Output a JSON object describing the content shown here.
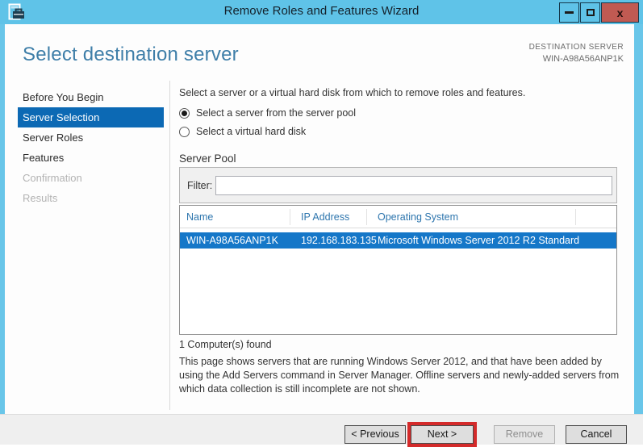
{
  "window": {
    "title": "Remove Roles and Features Wizard",
    "controls": {
      "minimize": "minimize",
      "maximize": "maximize",
      "close_glyph": "x"
    }
  },
  "header": {
    "title": "Select destination server",
    "destination_label": "DESTINATION SERVER",
    "destination_server": "WIN-A98A56ANP1K"
  },
  "sidebar": {
    "items": [
      {
        "label": "Before You Begin",
        "state": "enabled"
      },
      {
        "label": "Server Selection",
        "state": "selected"
      },
      {
        "label": "Server Roles",
        "state": "enabled"
      },
      {
        "label": "Features",
        "state": "enabled"
      },
      {
        "label": "Confirmation",
        "state": "disabled"
      },
      {
        "label": "Results",
        "state": "disabled"
      }
    ]
  },
  "content": {
    "intro": "Select a server or a virtual hard disk from which to remove roles and features.",
    "radio_server_pool": {
      "label": "Select a server from the server pool",
      "selected": true
    },
    "radio_vhd": {
      "label": "Select a virtual hard disk",
      "selected": false
    },
    "server_pool": {
      "title": "Server Pool",
      "filter_label": "Filter:",
      "filter_value": "",
      "table": {
        "columns": [
          "Name",
          "IP Address",
          "Operating System"
        ],
        "rows": [
          {
            "name": "WIN-A98A56ANP1K",
            "ip": "192.168.183.135",
            "os": "Microsoft Windows Server 2012 R2 Standard",
            "selected": true
          }
        ]
      },
      "count_text": "1 Computer(s) found"
    },
    "description": "This page shows servers that are running Windows Server 2012, and that have been added by using the Add Servers command in Server Manager. Offline servers and newly-added servers from which data collection is still incomplete are not shown."
  },
  "footer": {
    "buttons": [
      {
        "label": "< Previous",
        "state": "enabled",
        "annotated": false
      },
      {
        "label": "Next >",
        "state": "enabled",
        "annotated": true
      },
      {
        "label": "Remove",
        "state": "disabled",
        "annotated": false
      },
      {
        "label": "Cancel",
        "state": "enabled",
        "annotated": false
      }
    ]
  },
  "colors": {
    "titlebar": "#5fc3e8",
    "window_border": "#69c6e9",
    "close_button": "#c05a52",
    "heading_text": "#3e7ea8",
    "sidebar_selected": "#0c69b4",
    "row_selected": "#1577c8",
    "table_header_text": "#2e76ae",
    "annotation_red": "#d42a2a",
    "footer_bg": "#efefef"
  }
}
